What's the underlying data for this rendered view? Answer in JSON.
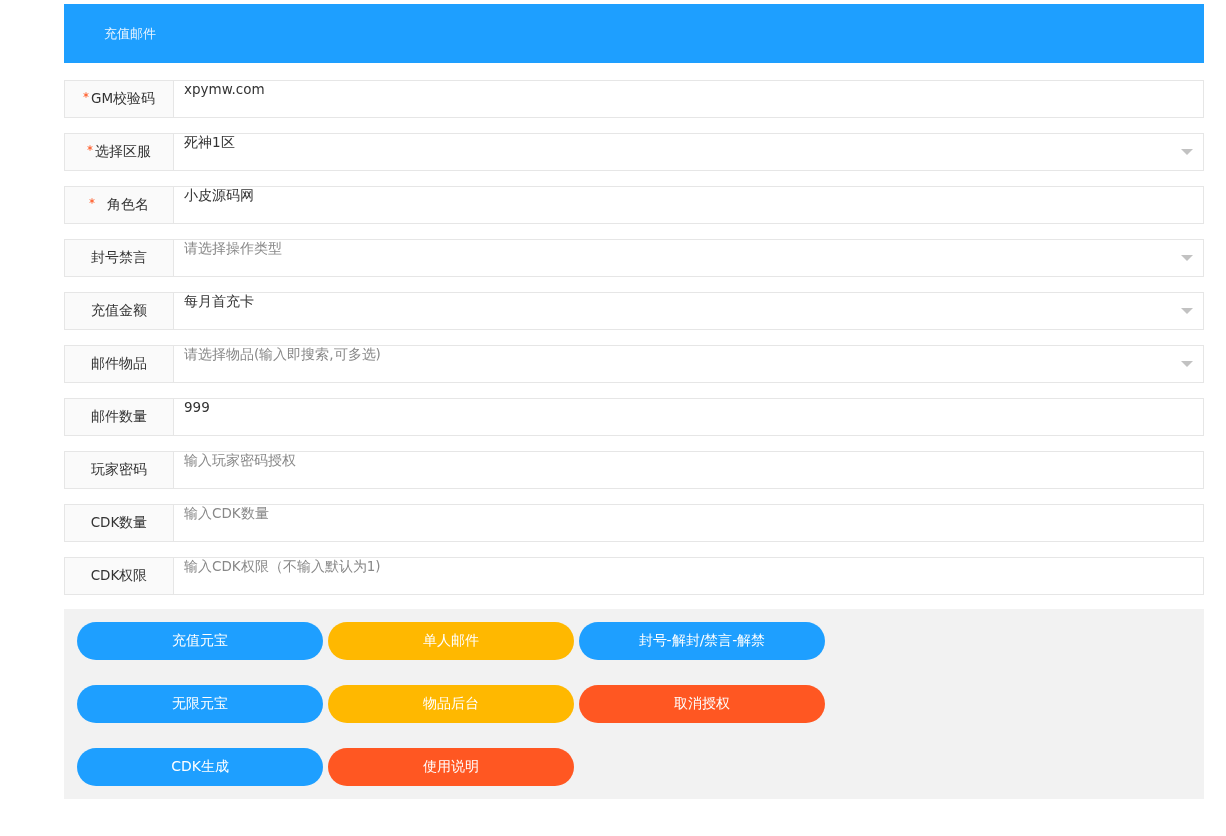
{
  "header": {
    "title": "充值邮件"
  },
  "fields": [
    {
      "label": "GM校验码",
      "required": true,
      "kind": "text",
      "value": "xpymw.com"
    },
    {
      "label": "选择区服",
      "required": true,
      "kind": "select",
      "value": "死神1区"
    },
    {
      "label": "角色名",
      "required": true,
      "kind": "text",
      "value": "小皮源码网"
    },
    {
      "label": "封号禁言",
      "required": false,
      "kind": "select",
      "placeholder": "请选择操作类型"
    },
    {
      "label": "充值金额",
      "required": false,
      "kind": "select",
      "value": "每月首充卡"
    },
    {
      "label": "邮件物品",
      "required": false,
      "kind": "select",
      "placeholder": "请选择物品(输入即搜索,可多选)"
    },
    {
      "label": "邮件数量",
      "required": false,
      "kind": "text",
      "value": "999"
    },
    {
      "label": "玩家密码",
      "required": false,
      "kind": "text",
      "placeholder": "输入玩家密码授权"
    },
    {
      "label": "CDK数量",
      "required": false,
      "kind": "text",
      "placeholder": "输入CDK数量"
    },
    {
      "label": "CDK权限",
      "required": false,
      "kind": "text",
      "placeholder": "输入CDK权限（不输入默认为1)"
    }
  ],
  "buttons": [
    {
      "label": "充值元宝",
      "color": "#1e9fff"
    },
    {
      "label": "单人邮件",
      "color": "#ffb800"
    },
    {
      "label": "封号-解封/禁言-解禁",
      "color": "#1e9fff"
    },
    {
      "label": "无限元宝",
      "color": "#1e9fff"
    },
    {
      "label": "物品后台",
      "color": "#ffb800"
    },
    {
      "label": "取消授权",
      "color": "#ff5722"
    },
    {
      "label": "CDK生成",
      "color": "#1e9fff"
    },
    {
      "label": "使用说明",
      "color": "#ff5722"
    }
  ]
}
